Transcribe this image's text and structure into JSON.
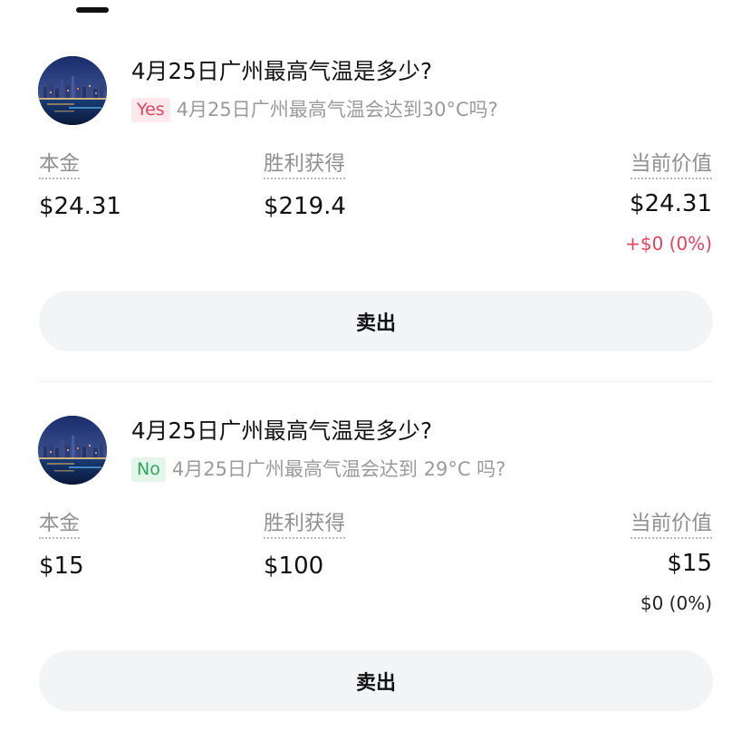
{
  "positions": [
    {
      "title": "4月25日广州最高气温是多少?",
      "badge": "Yes",
      "badge_color": "#e0445f",
      "question": "4月25日广州最高气温会达到30°C吗?",
      "principal_label": "本金",
      "principal_value": "$24.31",
      "win_label": "胜利获得",
      "win_value": "$219.4",
      "current_label": "当前价值",
      "current_value": "$24.31",
      "change": "+$0 (0%)",
      "change_color": "#e0445f",
      "sell_label": "卖出",
      "avatar_icon": "guangzhou-city-night-image"
    },
    {
      "title": "4月25日广州最高气温是多少?",
      "badge": "No",
      "badge_color": "#2fa85e",
      "question": "4月25日广州最高气温会达到 29°C 吗?",
      "principal_label": "本金",
      "principal_value": "$15",
      "win_label": "胜利获得",
      "win_value": "$100",
      "current_label": "当前价值",
      "current_value": "$15",
      "change": "$0 (0%)",
      "change_color": "#222222",
      "sell_label": "卖出",
      "avatar_icon": "guangzhou-city-night-image"
    }
  ]
}
